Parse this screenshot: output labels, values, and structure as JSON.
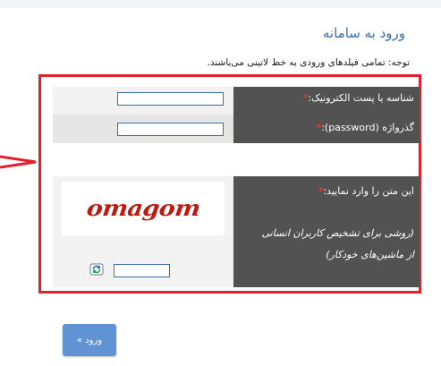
{
  "header": {
    "title": "ورود به سامانه",
    "note_prefix": "توجه: تمامی فیلدهای ورودی به خط لاتینی می‌باشند."
  },
  "form": {
    "email_label": "شناسه یا پست الکترونیک:",
    "password_label": "گذرواژه (password):",
    "required_mark": "*",
    "email_value": "",
    "password_value": "",
    "captcha_label": "این متن را وارد نمایید:",
    "captcha_hint_line1": "(روشی برای تشخیص کاربران انسانی",
    "captcha_hint_line2": "از ماشین‌های خودکار)",
    "captcha_text": "omagom",
    "captcha_value": ""
  },
  "actions": {
    "login_label": "ورود »"
  },
  "colors": {
    "frame_border": "#e0202a",
    "label_bg": "#525252",
    "title_color": "#3a6ea5",
    "button_bg": "#5f93d4",
    "captcha_text_color": "#c01a10"
  },
  "icons": {
    "refresh": "refresh-icon",
    "arrow": "arrow-pointer-icon"
  }
}
